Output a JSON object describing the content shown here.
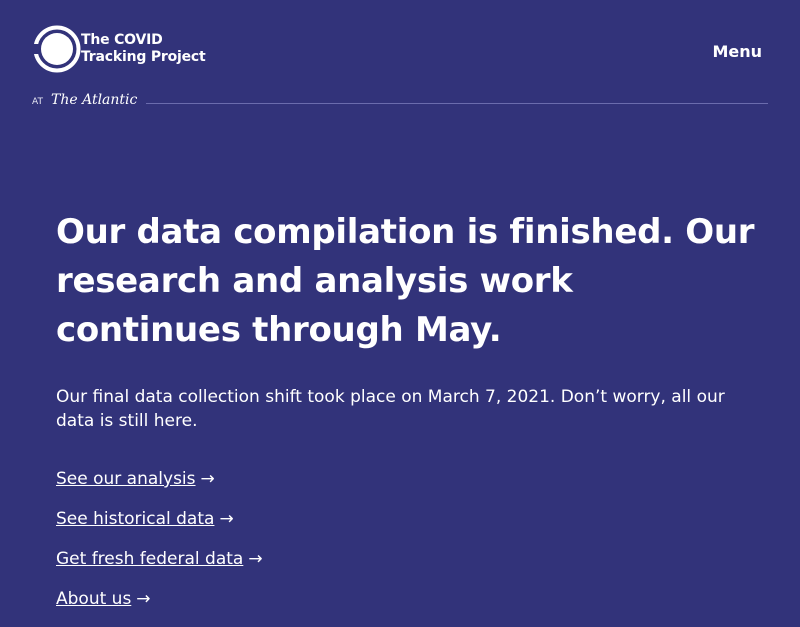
{
  "header": {
    "logo_line1": "The COVID",
    "logo_line2": "Tracking Project",
    "menu_label": "Menu",
    "at_label": "AT",
    "publisher": "The Atlantic"
  },
  "main": {
    "headline": "Our data compilation is finished. Our research and analysis work continues through May.",
    "intro": "Our final data collection shift took place on March 7, 2021. Don’t worry, all our data is still here.",
    "links": [
      {
        "label": "See our analysis",
        "arrow": "→"
      },
      {
        "label": "See historical data",
        "arrow": "→"
      },
      {
        "label": "Get fresh federal data",
        "arrow": "→"
      },
      {
        "label": "About us",
        "arrow": "→"
      }
    ]
  },
  "colors": {
    "background": "#32337a",
    "text": "#ffffff",
    "rule": "#6b6cad"
  }
}
